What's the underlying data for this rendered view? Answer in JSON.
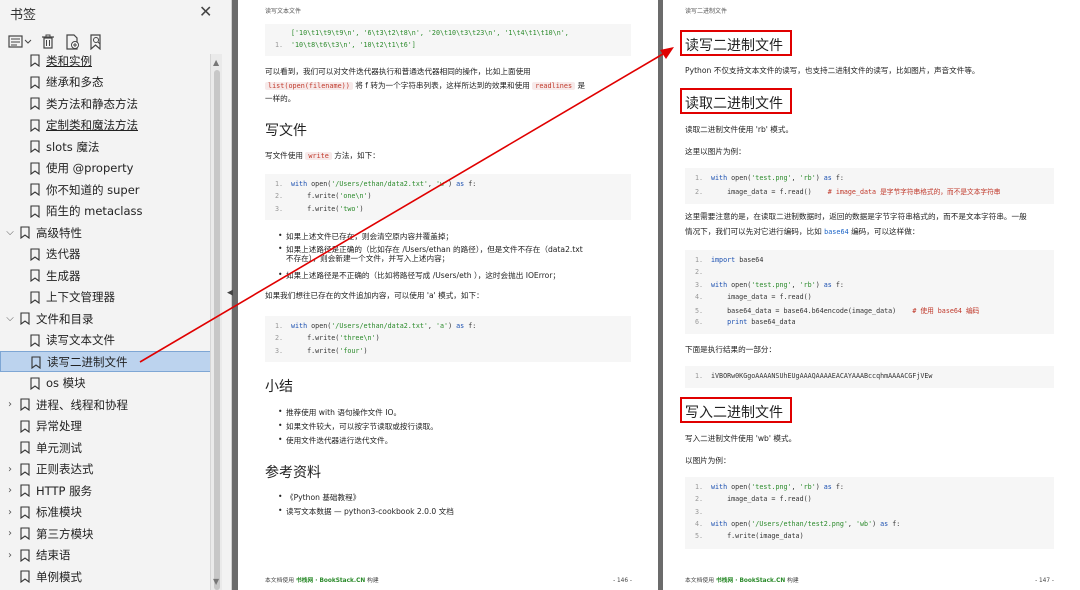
{
  "sidebar": {
    "title": "书签",
    "close_icon": "close-icon",
    "items": [
      {
        "label": "类和实例",
        "expandable": false,
        "level": 1
      },
      {
        "label": "继承和多态",
        "expandable": false,
        "level": 1
      },
      {
        "label": "类方法和静态方法",
        "expandable": false,
        "level": 1
      },
      {
        "label": "定制类和魔法方法",
        "expandable": false,
        "level": 1
      },
      {
        "label": "slots 魔法",
        "expandable": false,
        "level": 1
      },
      {
        "label": "使用 @property",
        "expandable": false,
        "level": 1
      },
      {
        "label": "你不知道的 super",
        "expandable": false,
        "level": 1
      },
      {
        "label": "陌生的 metaclass",
        "expandable": false,
        "level": 1
      },
      {
        "label": "高级特性",
        "expandable": "open",
        "level": 0
      },
      {
        "label": "迭代器",
        "expandable": false,
        "level": 1
      },
      {
        "label": "生成器",
        "expandable": false,
        "level": 1
      },
      {
        "label": "上下文管理器",
        "expandable": false,
        "level": 1
      },
      {
        "label": "文件和目录",
        "expandable": "open",
        "level": 0
      },
      {
        "label": "读写文本文件",
        "expandable": false,
        "level": 1
      },
      {
        "label": "读写二进制文件",
        "expandable": false,
        "level": 1,
        "selected": true
      },
      {
        "label": "os 模块",
        "expandable": false,
        "level": 1
      },
      {
        "label": "进程、线程和协程",
        "expandable": "closed",
        "level": 0
      },
      {
        "label": "异常处理",
        "expandable": false,
        "level": 0
      },
      {
        "label": "单元测试",
        "expandable": false,
        "level": 0
      },
      {
        "label": "正则表达式",
        "expandable": "closed",
        "level": 0
      },
      {
        "label": "HTTP 服务",
        "expandable": "closed",
        "level": 0
      },
      {
        "label": "标准模块",
        "expandable": "closed",
        "level": 0
      },
      {
        "label": "第三方模块",
        "expandable": "closed",
        "level": 0
      },
      {
        "label": "结束语",
        "expandable": "closed",
        "level": 0
      },
      {
        "label": "单例模式",
        "expandable": false,
        "level": 0
      }
    ]
  },
  "page1": {
    "header": "读写文本文件",
    "code0": [
      "['10\\t1\\t9\\t9\\n', '6\\t3\\t2\\t8\\n', '20\\t10\\t3\\t23\\n', '1\\t4\\t1\\t10\\n',",
      "'10\\t8\\t6\\t3\\n', '10\\t2\\t1\\t6']"
    ],
    "para1a": "可以看到，我们可以对文件迭代器执行和普通迭代器相同的操作，比如上面使用",
    "para1_code1": "list(open(filename))",
    "para1b": "将 f 转为一个字符串列表，这样所达到的效果和使用",
    "para1_code2": "readlines",
    "para1c": "是",
    "para1d": "一样的。",
    "h_write": "写文件",
    "write_intro_a": "写文件使用",
    "write_code": "write",
    "write_intro_b": "方法，如下：",
    "code1": [
      {
        "n": "1.",
        "t": "with open('/Users/ethan/data2.txt', 'w') as f:"
      },
      {
        "n": "2.",
        "t": "    f.write('one\\n')"
      },
      {
        "n": "3.",
        "t": "    f.write('two')"
      }
    ],
    "bullets1": [
      "如果上述文件已存在，则会清空原内容并覆盖掉；",
      "如果上述路径是正确的（比如存在 /Users/ethan 的路径），但是文件不存在（data2.txt",
      "不存在），则会新建一个文件，并写入上述内容；",
      "如果上述路径是不正确的（比如将路径写成 /Users/eth ），这时会抛出 IOError；"
    ],
    "append_intro": "如果我们想往已存在的文件追加内容，可以使用 'a' 模式，如下：",
    "code2": [
      {
        "n": "1.",
        "t": "with open('/Users/ethan/data2.txt', 'a') as f:"
      },
      {
        "n": "2.",
        "t": "    f.write('three\\n')"
      },
      {
        "n": "3.",
        "t": "    f.write('four')"
      }
    ],
    "h_summary": "小结",
    "bullets2": [
      "推荐使用 with 语句操作文件 IO。",
      "如果文件较大，可以按字节读取或按行读取。",
      "使用文件迭代器进行迭代文件。"
    ],
    "h_refs": "参考资料",
    "refs": [
      "《Python 基础教程》",
      "读写文本数据 — python3-cookbook 2.0.0 文档"
    ],
    "footer_a": "本文档使用",
    "footer_b": "书栈网 · BookStack.CN",
    "footer_c": "构建",
    "page_num": "- 146 -"
  },
  "page2": {
    "header": "读写二进制文件",
    "h_main": "读写二进制文件",
    "intro": "Python 不仅支持文本文件的读写，也支持二进制文件的读写，比如图片，声音文件等。",
    "h_read": "读取二进制文件",
    "read_mode": "读取二进制文件使用 'rb' 模式。",
    "example_img": "这里以图片为例：",
    "code1": [
      {
        "n": "1.",
        "t": "with open('test.png', 'rb') as f:"
      },
      {
        "n": "2.",
        "t": "    image_data = f.read()",
        "c": "    # image_data 是字节字符串格式的，而不是文本字符串"
      }
    ],
    "note1": "这里需要注意的是，在读取二进制数据时，返回的数据是字节字符串格式的，而不是文本字符串。一般",
    "note2a": "情况下，我们可以先对它进行编码，比如",
    "note2_code": "base64",
    "note2b": "编码，可以这样做：",
    "code2": [
      {
        "n": "1.",
        "t": "import base64"
      },
      {
        "n": "2.",
        "t": ""
      },
      {
        "n": "3.",
        "t": "with open('test.png', 'rb') as f:"
      },
      {
        "n": "4.",
        "t": "    image_data = f.read()"
      },
      {
        "n": "5.",
        "t": "    base64_data = base64.b64encode(image_data)",
        "c": "    # 使用 base64 编码"
      },
      {
        "n": "6.",
        "t": "    print base64_data"
      }
    ],
    "result_intro": "下面是执行结果的一部分：",
    "code3": [
      {
        "n": "1.",
        "t": "iVBORw0KGgoAAAANSUhEUgAAAQAAAAEACAYAAABccqhmAAAACGFjVEw"
      }
    ],
    "h_write": "写入二进制文件",
    "write_mode": "写入二进制文件使用 'wb' 模式。",
    "example_img2": "以图片为例：",
    "code4": [
      {
        "n": "1.",
        "t": "with open('test.png', 'rb') as f:"
      },
      {
        "n": "2.",
        "t": "    image_data = f.read()"
      },
      {
        "n": "3.",
        "t": ""
      },
      {
        "n": "4.",
        "t": "with open('/Users/ethan/test2.png', 'wb') as f:"
      },
      {
        "n": "5.",
        "t": "    f.write(image_data)"
      }
    ],
    "footer_a": "本文档使用",
    "footer_b": "书栈网 · BookStack.CN",
    "footer_c": "构建",
    "page_num": "- 147 -"
  },
  "colors": {
    "highlight_box": "#e00000",
    "selection": "#bcd3ee",
    "link": "#1a63c6"
  }
}
